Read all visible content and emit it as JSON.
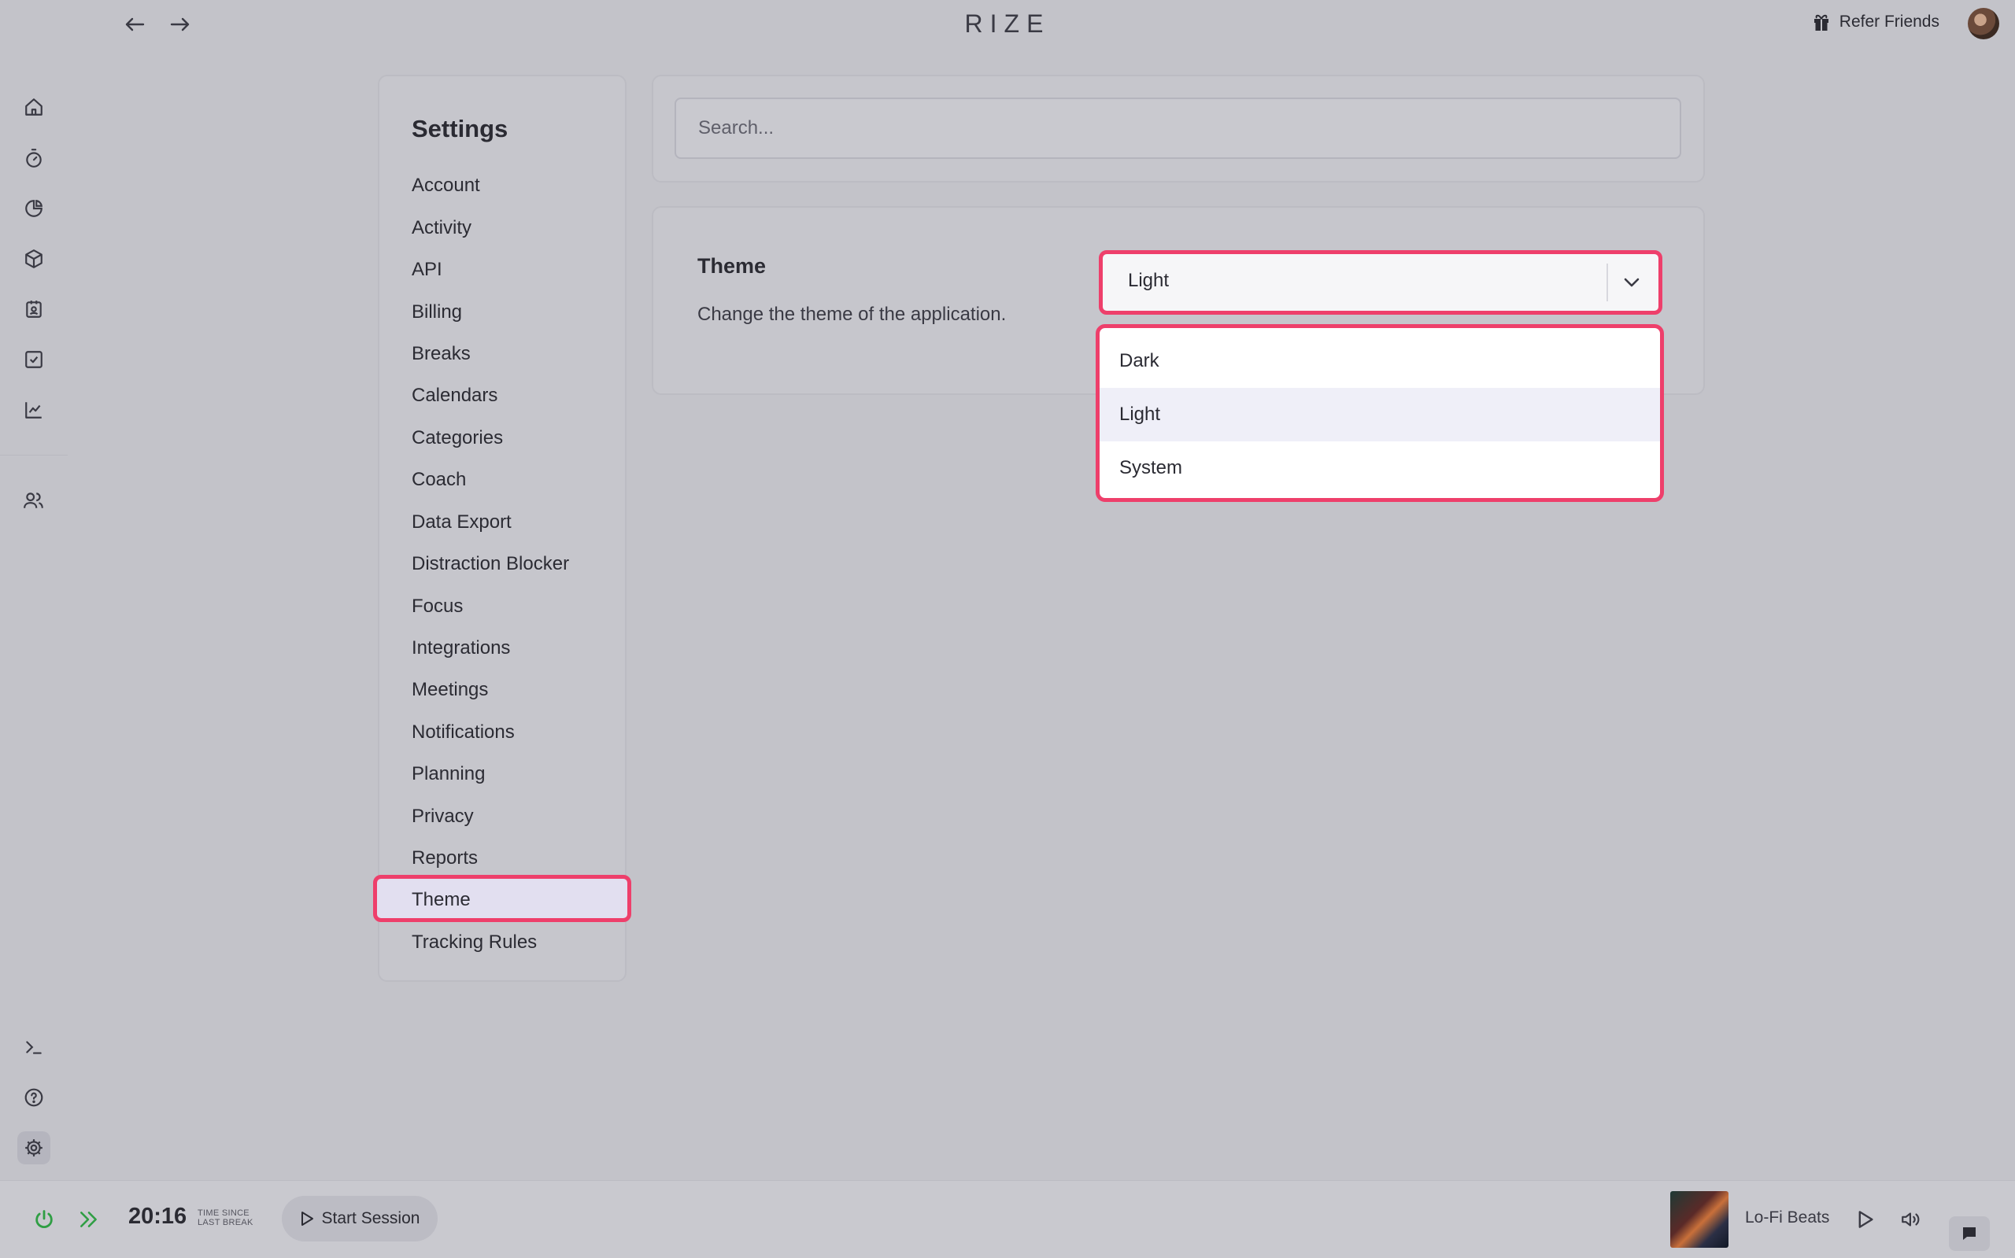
{
  "app": {
    "title": "RIZE"
  },
  "header": {
    "refer_label": "Refer Friends"
  },
  "settings": {
    "title": "Settings",
    "menu": [
      "Account",
      "Activity",
      "API",
      "Billing",
      "Breaks",
      "Calendars",
      "Categories",
      "Coach",
      "Data Export",
      "Distraction Blocker",
      "Focus",
      "Integrations",
      "Meetings",
      "Notifications",
      "Planning",
      "Privacy",
      "Reports",
      "Theme",
      "Tracking Rules"
    ],
    "active_item": "Theme"
  },
  "search": {
    "placeholder": "Search..."
  },
  "theme": {
    "title": "Theme",
    "description": "Change the theme of the application.",
    "selected": "Light",
    "options": [
      "Dark",
      "Light",
      "System"
    ]
  },
  "footer": {
    "timer": "20:16",
    "timer_label_1": "TIME SINCE",
    "timer_label_2": "LAST BREAK",
    "start_label": "Start Session",
    "track": "Lo-Fi Beats"
  },
  "colors": {
    "highlight": "#ee3f6b",
    "accent_green": "#2f9e44",
    "background": "#c3c3c9"
  },
  "icons": {
    "rail": [
      "home-icon",
      "timer-icon",
      "pie-chart-icon",
      "cube-icon",
      "calendar-badge-icon",
      "checklist-icon",
      "line-chart-icon",
      "users-icon"
    ],
    "rail_bottom": [
      "terminal-icon",
      "help-icon",
      "gear-icon"
    ]
  }
}
